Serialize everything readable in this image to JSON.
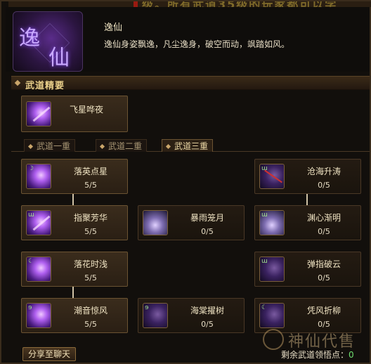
{
  "banner": {
    "text": "级。所有武道35级的玩家都可以学"
  },
  "skill": {
    "emblem_chars": [
      "逸",
      "仙"
    ],
    "name": "逸仙",
    "description": "逸仙身姿飘逸，凡尘逸身，破空而动，飒踏如风。"
  },
  "section": {
    "title": "武道精要"
  },
  "essence": {
    "label": "飞星哗夜",
    "icon": "purple-slash-icon"
  },
  "tabs": [
    {
      "label": "武道一重",
      "active": false
    },
    {
      "label": "武道二重",
      "active": false
    },
    {
      "label": "武道三重",
      "active": true
    }
  ],
  "nodes": {
    "luoyingdianxing": {
      "name": "落英点星",
      "level": "5/5",
      "icon": "crescent-petal-icon"
    },
    "canghaishengtao": {
      "name": "沧海升涛",
      "level": "0/5",
      "icon": "crossed-wave-icon"
    },
    "zhijufanghua": {
      "name": "指聚芳华",
      "level": "5/5",
      "icon": "bright-slash-icon"
    },
    "baoyulongyue": {
      "name": "暴雨笼月",
      "level": "0/5",
      "icon": "rain-moon-icon"
    },
    "yuanxinjianming": {
      "name": "渊心渐明",
      "level": "0/5",
      "icon": "abyss-light-icon"
    },
    "luohuashiqian": {
      "name": "落花时浅",
      "level": "5/5",
      "icon": "falling-flower-icon"
    },
    "tanzhipoyun": {
      "name": "弹指破云",
      "level": "0/5",
      "icon": "flick-cloud-icon"
    },
    "chaoyinjingfeng": {
      "name": "潮音惊风",
      "level": "5/5",
      "icon": "tide-sound-icon"
    },
    "haitangzhuoshu": {
      "name": "海棠擢树",
      "level": "0/5",
      "icon": "begonia-icon"
    },
    "pingfengzheliu": {
      "name": "凭风折柳",
      "level": "0/5",
      "icon": "willow-icon"
    }
  },
  "footer": {
    "share_label": "分享至聊天",
    "remaining_label": "剩余武道领悟点：",
    "remaining_value": "0"
  },
  "watermark": {
    "text": "神仙代售"
  }
}
